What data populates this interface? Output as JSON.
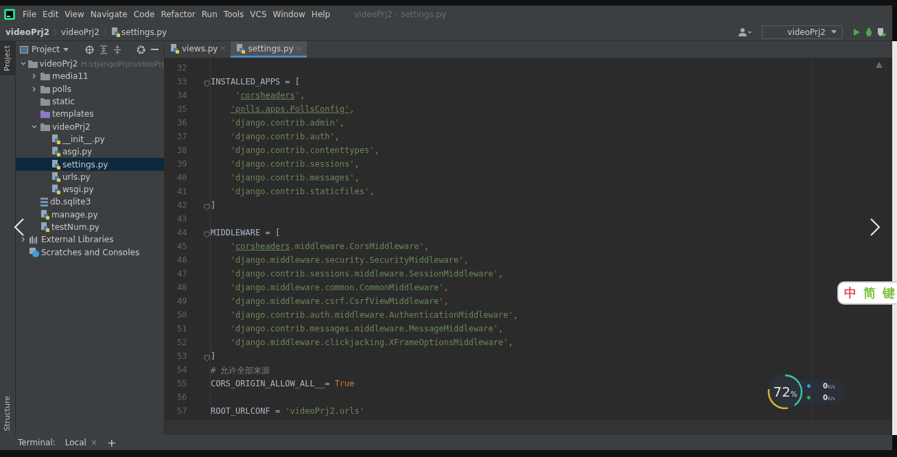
{
  "menu": [
    "File",
    "Edit",
    "View",
    "Navigate",
    "Code",
    "Refactor",
    "Run",
    "Tools",
    "VCS",
    "Window",
    "Help"
  ],
  "window_title": "videoPrj2 - settings.py",
  "breadcrumbs": [
    "videoPrj2",
    "videoPrj2",
    "settings.py"
  ],
  "run_config": "videoPrj2",
  "side_tabs": {
    "top": "Project",
    "bottom": "Structure"
  },
  "project_panel": {
    "title": "Project",
    "tree": [
      {
        "label": "videoPrj2",
        "kind": "folder",
        "hint": "H:\\djangoPrjs\\videoPrj",
        "expanded": true,
        "selected": false,
        "children": [
          {
            "label": "media11",
            "kind": "folder",
            "expanded": false,
            "selected": false
          },
          {
            "label": "polls",
            "kind": "package",
            "expanded": false,
            "selected": false
          },
          {
            "label": "static",
            "kind": "folder",
            "selected": false
          },
          {
            "label": "templates",
            "kind": "template",
            "selected": false
          },
          {
            "label": "videoPrj2",
            "kind": "package",
            "expanded": true,
            "selected": false,
            "children": [
              {
                "label": "__init__.py",
                "kind": "python",
                "selected": false
              },
              {
                "label": "asgi.py",
                "kind": "python",
                "selected": false
              },
              {
                "label": "settings.py",
                "kind": "python",
                "selected": true
              },
              {
                "label": "urls.py",
                "kind": "python",
                "selected": false
              },
              {
                "label": "wsgi.py",
                "kind": "python",
                "selected": false
              }
            ]
          },
          {
            "label": "db.sqlite3",
            "kind": "db",
            "selected": false
          },
          {
            "label": "manage.py",
            "kind": "python",
            "selected": false
          },
          {
            "label": "testNum.py",
            "kind": "python",
            "selected": false
          }
        ]
      },
      {
        "label": "External Libraries",
        "kind": "libraries",
        "expanded": false,
        "selected": false
      },
      {
        "label": "Scratches and Consoles",
        "kind": "scratches",
        "selected": false
      }
    ]
  },
  "editor_tabs": [
    {
      "label": "views.py",
      "selected": false
    },
    {
      "label": "settings.py",
      "selected": true
    }
  ],
  "code_lines": [
    {
      "number": "32"
    },
    {
      "number": "33",
      "fold": true,
      "segments": [
        {
          "kind": "name",
          "text": "INSTALLED_APPS = ["
        }
      ]
    },
    {
      "number": "34",
      "indented": true,
      "segments": [
        {
          "kind": "str",
          "text": " '"
        },
        {
          "kind": "strref",
          "text": "corsheaders"
        },
        {
          "kind": "str",
          "text": "'"
        },
        {
          "kind": "comma",
          "text": ","
        }
      ]
    },
    {
      "number": "35",
      "indented": true,
      "segments": [
        {
          "kind": "strref",
          "text": "'polls.apps.PollsConfig'"
        },
        {
          "kind": "comma",
          "text": ","
        }
      ]
    },
    {
      "number": "36",
      "indented": true,
      "segments": [
        {
          "kind": "str",
          "text": "'django.contrib.admin'"
        },
        {
          "kind": "comma",
          "text": ","
        }
      ]
    },
    {
      "number": "37",
      "indented": true,
      "segments": [
        {
          "kind": "str",
          "text": "'django.contrib.auth'"
        },
        {
          "kind": "comma",
          "text": ","
        }
      ]
    },
    {
      "number": "38",
      "indented": true,
      "segments": [
        {
          "kind": "str",
          "text": "'django.contrib.contenttypes'"
        },
        {
          "kind": "comma",
          "text": ","
        }
      ]
    },
    {
      "number": "39",
      "indented": true,
      "segments": [
        {
          "kind": "str",
          "text": "'django.contrib.sessions'"
        },
        {
          "kind": "comma",
          "text": ","
        }
      ]
    },
    {
      "number": "40",
      "indented": true,
      "segments": [
        {
          "kind": "str",
          "text": "'django.contrib.messages'"
        },
        {
          "kind": "comma",
          "text": ","
        }
      ]
    },
    {
      "number": "41",
      "indented": true,
      "segments": [
        {
          "kind": "str",
          "text": "'django.contrib.staticfiles'"
        },
        {
          "kind": "comma",
          "text": ","
        }
      ]
    },
    {
      "number": "42",
      "fold": true,
      "segments": [
        {
          "kind": "name",
          "text": "]"
        }
      ]
    },
    {
      "number": "43"
    },
    {
      "number": "44",
      "fold": true,
      "segments": [
        {
          "kind": "name",
          "text": "MIDDLEWARE = ["
        }
      ]
    },
    {
      "number": "45",
      "indented": true,
      "segments": [
        {
          "kind": "str",
          "text": "'"
        },
        {
          "kind": "strref",
          "text": "corsheaders"
        },
        {
          "kind": "str",
          "text": ".middleware.CorsMiddleware'"
        },
        {
          "kind": "comma",
          "text": ","
        }
      ]
    },
    {
      "number": "46",
      "indented": true,
      "segments": [
        {
          "kind": "str",
          "text": "'django.middleware.security.SecurityMiddleware'"
        },
        {
          "kind": "comma",
          "text": ","
        }
      ]
    },
    {
      "number": "47",
      "indented": true,
      "segments": [
        {
          "kind": "str",
          "text": "'django.contrib.sessions.middleware.SessionMiddleware'"
        },
        {
          "kind": "comma",
          "text": ","
        }
      ]
    },
    {
      "number": "48",
      "indented": true,
      "segments": [
        {
          "kind": "str",
          "text": "'django.middleware.common.CommonMiddleware'"
        },
        {
          "kind": "comma",
          "text": ","
        }
      ]
    },
    {
      "number": "49",
      "indented": true,
      "segments": [
        {
          "kind": "str",
          "text": "'django.middleware.csrf.CsrfViewMiddleware'"
        },
        {
          "kind": "comma",
          "text": ","
        }
      ]
    },
    {
      "number": "50",
      "indented": true,
      "segments": [
        {
          "kind": "str",
          "text": "'django.contrib.auth.middleware.AuthenticationMiddleware'"
        },
        {
          "kind": "comma",
          "text": ","
        }
      ]
    },
    {
      "number": "51",
      "indented": true,
      "segments": [
        {
          "kind": "str",
          "text": "'django.contrib.messages.middleware.MessageMiddleware'"
        },
        {
          "kind": "comma",
          "text": ","
        }
      ]
    },
    {
      "number": "52",
      "indented": true,
      "segments": [
        {
          "kind": "str",
          "text": "'django.middleware.clickjacking.XFrameOptionsMiddleware'"
        },
        {
          "kind": "comma",
          "text": ","
        }
      ]
    },
    {
      "number": "53",
      "fold": true,
      "segments": [
        {
          "kind": "name",
          "text": "]"
        }
      ]
    },
    {
      "number": "54",
      "segments": [
        {
          "kind": "comment",
          "text": "# 允许全部来源"
        }
      ]
    },
    {
      "number": "55",
      "segments": [
        {
          "kind": "name",
          "text": "CORS_ORIGIN_ALLOW_ALL__= "
        },
        {
          "kind": "keyword",
          "text": "True"
        }
      ]
    },
    {
      "number": "56"
    },
    {
      "number": "57",
      "segments": [
        {
          "kind": "name",
          "text": "ROOT_URLCONF = "
        },
        {
          "kind": "str",
          "text": "'videoPrj2.urls'"
        }
      ]
    }
  ],
  "terminal": {
    "label": "Terminal:",
    "tab": "Local",
    "close": "×",
    "add": "+"
  },
  "memory_widget": {
    "percent": "72",
    "unit": "%",
    "rates": [
      {
        "value": "0",
        "unit": "K/s",
        "color": "#3a9ee0"
      },
      {
        "value": "0",
        "unit": "K/s",
        "color": "#3cb050"
      }
    ]
  },
  "ime_widget": [
    {
      "text": "中",
      "color": "#e0505a"
    },
    {
      "text": "简",
      "color": "#7cbf3c"
    },
    {
      "text": "键",
      "color": "#7cbf3c"
    }
  ]
}
